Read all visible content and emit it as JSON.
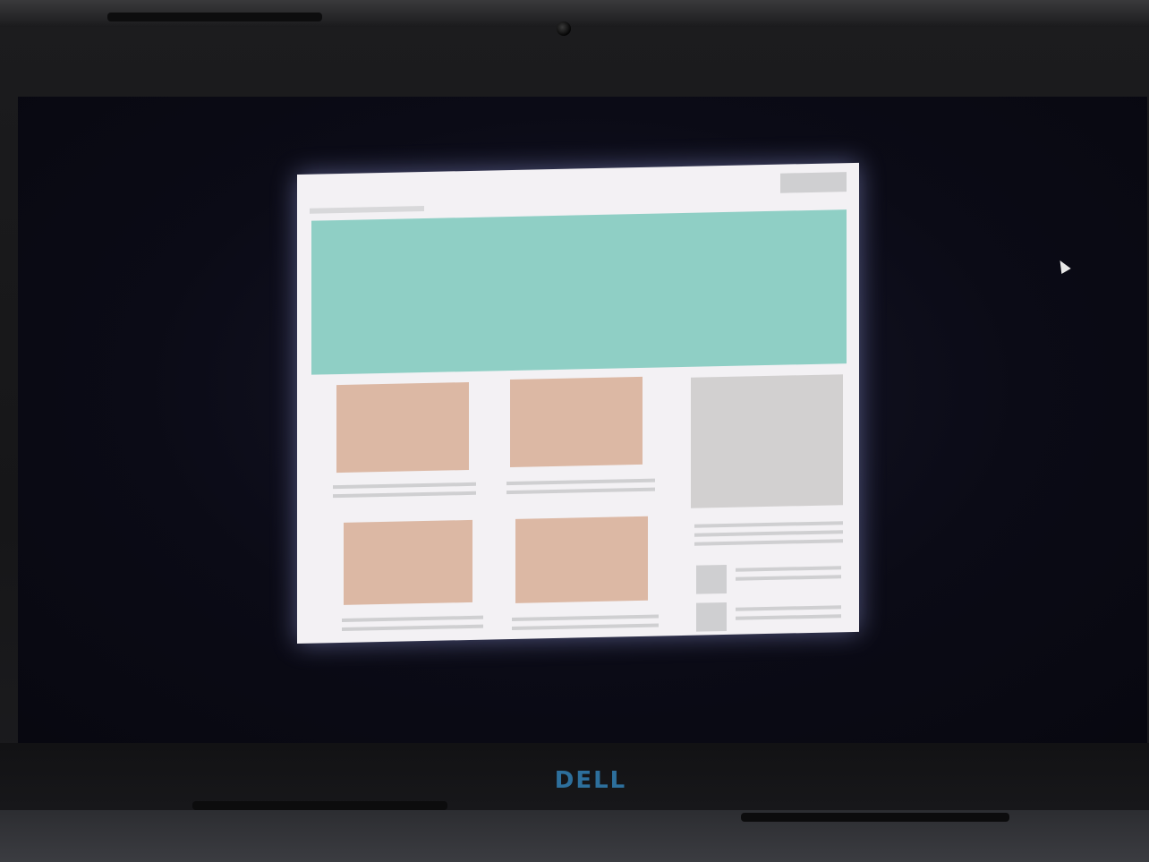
{
  "device": {
    "brand_logo": "DELL",
    "webcam": "webcam-icon"
  },
  "screen": {
    "cursor": "mouse-pointer-icon"
  },
  "wireframe_page": {
    "title_placeholder": "",
    "header_button_placeholder": "",
    "hero_color": "#8fcfc5",
    "card_color": "#dcb8a4",
    "placeholder_gray": "#cfcfd1",
    "cards": [
      {
        "caption_lines": 2
      },
      {
        "caption_lines": 2
      },
      {
        "caption_lines": 2
      },
      {
        "caption_lines": 2
      }
    ],
    "sidebar": {
      "feature_text_lines": 3,
      "list_items": [
        {
          "text_lines": 2
        },
        {
          "text_lines": 2
        }
      ]
    }
  },
  "colors": {
    "screen_background": "#0b0b16",
    "logo": "#2d6f9c"
  }
}
